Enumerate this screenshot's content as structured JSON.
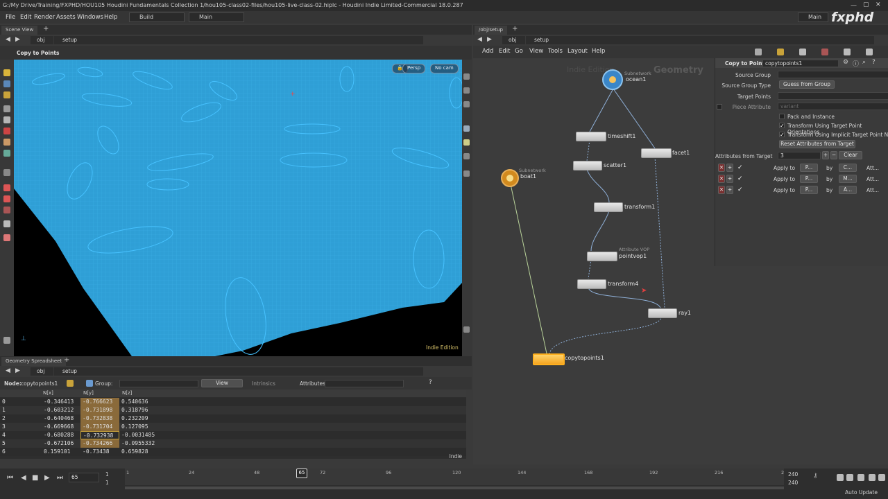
{
  "window_title": "G:/My Drive/Training/FXPHD/HOU105 Houdini Fundamentals Collection 1/hou105-class02-files/hou105-live-class-02.hiplc - Houdini Indie Limited-Commercial 18.0.287",
  "menubar": {
    "items": [
      "File",
      "Edit",
      "Render",
      "Assets",
      "Windows",
      "Help"
    ],
    "desktop": "Build",
    "layout": "Main",
    "right_desktop": "Main",
    "logo": "fxphd"
  },
  "scene_view": {
    "tab": "Scene View",
    "path": [
      "obj",
      "setup"
    ],
    "tool_title": "Copy to Points",
    "persp_btn": "Persp",
    "cam_btn": "No cam",
    "watermark": "Indie Edition"
  },
  "spreadsheet": {
    "tab": "Geometry Spreadsheet",
    "path": [
      "obj",
      "setup"
    ],
    "node_label": "Node:",
    "node_name": "copytopoints1",
    "group_label": "Group:",
    "view_label": "View",
    "intrinsics_label": "Intrinsics",
    "attributes_label": "Attributes:",
    "columns": [
      "",
      "N[x]",
      "N[y]",
      "N[z]"
    ],
    "rows": [
      [
        "0",
        "-0.346413",
        "-0.766623",
        "0.540636"
      ],
      [
        "1",
        "-0.603212",
        "-0.731898",
        "0.318796"
      ],
      [
        "2",
        "-0.640468",
        "-0.732838",
        "0.232209"
      ],
      [
        "3",
        "-0.669668",
        "-0.731704",
        "0.127095"
      ],
      [
        "4",
        "-0.680288",
        "-0.732938",
        "-0.0031485"
      ],
      [
        "5",
        "-0.672106",
        "-0.734266",
        "-0.0955332"
      ],
      [
        "6",
        "0.159101",
        "-0.73438",
        "0.659828"
      ]
    ],
    "footer": "Indie"
  },
  "network": {
    "tab": "/obj/setup",
    "path": [
      "obj",
      "setup"
    ],
    "menu": [
      "Add",
      "Edit",
      "Go",
      "View",
      "Tools",
      "Layout",
      "Help"
    ],
    "watermark_left": "Indie Edition",
    "watermark_right": "Geometry",
    "nodes": {
      "ocean": {
        "name": "ocean1",
        "sub": "Subnetwork"
      },
      "boat": {
        "name": "boat1",
        "sub": "Subnetwork"
      },
      "timeshift": {
        "name": "timeshift1"
      },
      "facet": {
        "name": "facet1"
      },
      "scatter": {
        "name": "scatter1"
      },
      "transform1": {
        "name": "transform1"
      },
      "pointvop": {
        "name": "pointvop1",
        "sub": "Attribute VOP"
      },
      "transform4": {
        "name": "transform4"
      },
      "ray": {
        "name": "ray1"
      },
      "copytopoints": {
        "name": "copytopoints1"
      }
    }
  },
  "parameters": {
    "node_type": "Copy to Points",
    "node_name": "copytopoints1",
    "source_group_label": "Source Group",
    "source_group_type_label": "Source Group Type",
    "source_group_type_value": "Guess from Group",
    "target_points_label": "Target Points",
    "piece_attribute_label": "Piece Attribute",
    "piece_attribute_value": "variant",
    "pack_label": "Pack and Instance",
    "orient_label": "Transform Using Target Point Orientations",
    "normals_label": "Transform Using Implicit Target Point Normals",
    "reset_btn": "Reset Attributes from Target",
    "attrs_from_target_label": "Attributes from Target",
    "attrs_count": "3",
    "clear_btn": "Clear",
    "attr_rows": [
      {
        "apply": "Apply to",
        "target": "P...",
        "by": "by",
        "op": "C...",
        "attr": "Att..."
      },
      {
        "apply": "Apply to",
        "target": "P...",
        "by": "by",
        "op": "M...",
        "attr": "Att..."
      },
      {
        "apply": "Apply to",
        "target": "P...",
        "by": "by",
        "op": "A...",
        "attr": "Att..."
      }
    ]
  },
  "timeline": {
    "current_frame": "65",
    "start": "1",
    "start2": "1",
    "end": "240",
    "end2": "240",
    "ticks": [
      "1",
      "24",
      "48",
      "72",
      "96",
      "120",
      "144",
      "168",
      "192",
      "216",
      "2"
    ],
    "marker": "65",
    "auto_update": "Auto Update"
  },
  "colors": {
    "ocean": "#2fa0d8",
    "boats": "#3ab8ff",
    "node_selected": "#f5a623"
  }
}
